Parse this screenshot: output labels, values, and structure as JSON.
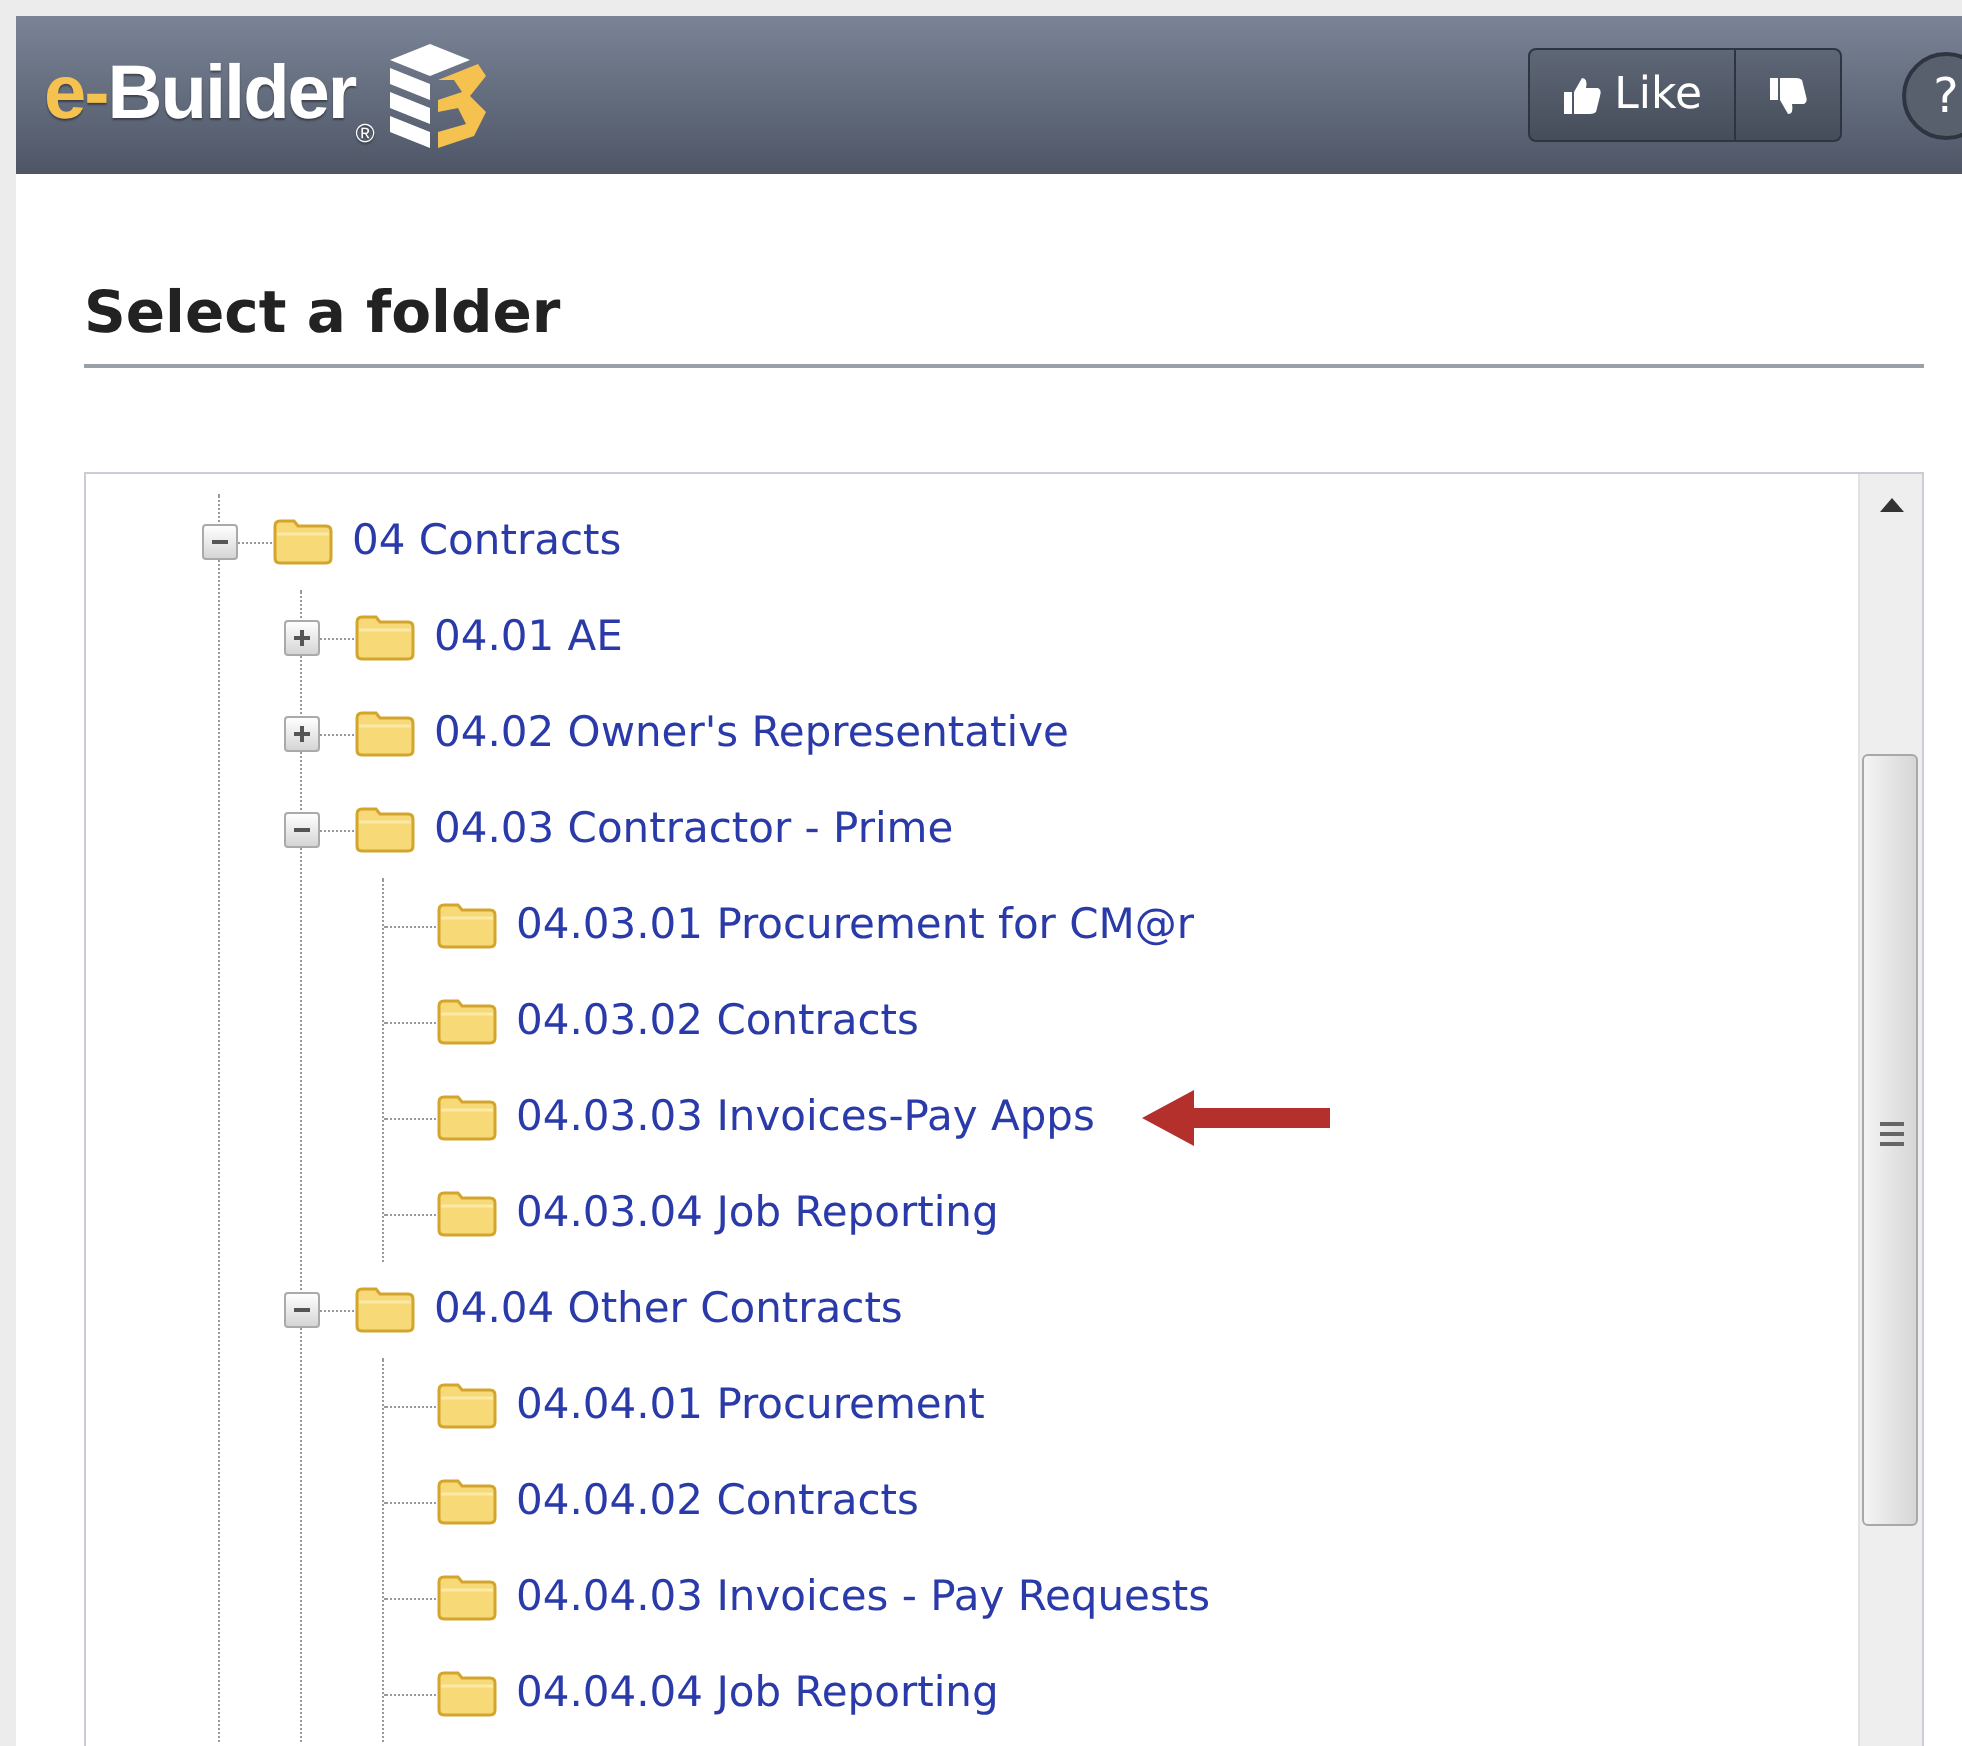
{
  "header": {
    "logo": {
      "prefix": "e-",
      "name": "Builder",
      "mark": "®"
    },
    "like_button": {
      "label": "Like"
    },
    "help_button": {
      "label": "?"
    }
  },
  "title": "Select a folder",
  "tree": [
    {
      "label": "04 Contracts",
      "expanded": true,
      "marked": false,
      "children": [
        {
          "label": "04.01 AE",
          "expanded": false,
          "marked": false
        },
        {
          "label": "04.02 Owner's Representative",
          "expanded": false,
          "marked": false
        },
        {
          "label": "04.03 Contractor - Prime",
          "expanded": true,
          "marked": false,
          "children": [
            {
              "label": "04.03.01 Procurement for CM@r",
              "marked": false
            },
            {
              "label": "04.03.02 Contracts",
              "marked": false
            },
            {
              "label": "04.03.03 Invoices-Pay Apps",
              "marked": true
            },
            {
              "label": "04.03.04 Job Reporting",
              "marked": false
            }
          ]
        },
        {
          "label": "04.04 Other Contracts",
          "expanded": true,
          "marked": false,
          "children": [
            {
              "label": "04.04.01 Procurement",
              "marked": false
            },
            {
              "label": "04.04.02 Contracts",
              "marked": false
            },
            {
              "label": "04.04.03 Invoices - Pay Requests",
              "marked": false
            },
            {
              "label": "04.04.04 Job Reporting",
              "marked": false
            }
          ]
        }
      ]
    }
  ]
}
